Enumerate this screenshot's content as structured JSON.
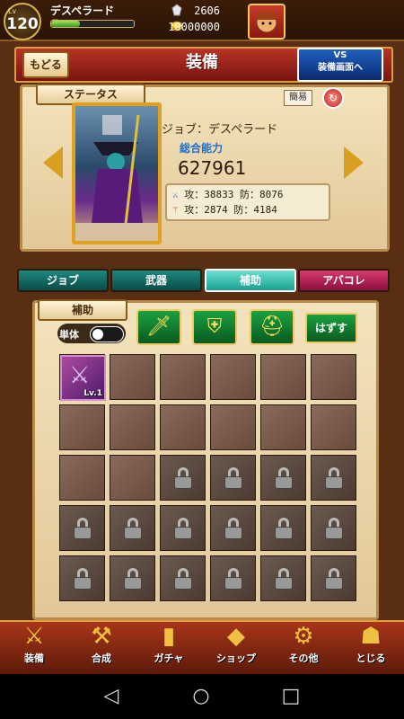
{
  "top_bar": {
    "level_tag": "Lv",
    "level": "120",
    "player_name": "デスペラード",
    "ep_label": "EP",
    "ep_fraction": 0.35,
    "currency1": "2606",
    "currency2": "10000000"
  },
  "header": {
    "back_label": "もどる",
    "title": "装備",
    "vs_line1": "VS",
    "vs_line2": "装備画面へ"
  },
  "status": {
    "tag": "ステータス",
    "simple_label": "簡易",
    "job_line": "ジョブ：デスペラード",
    "power_label": "総合能力",
    "power_value": "627961",
    "row1": "攻：38833  防：8076",
    "row2": "攻：2874   防：4184"
  },
  "tabs": [
    "ジョブ",
    "武器",
    "補助",
    "アバコレ"
  ],
  "support": {
    "tag": "補助",
    "single_label": "単体",
    "unequip_label": "はずす",
    "card_level": "Lv.1"
  },
  "bottom_menu": [
    "装備",
    "合成",
    "ガチャ",
    "ショップ",
    "その他",
    "とじる"
  ],
  "colors": {
    "accent": "#d8a020",
    "header_red": "#b83426",
    "tab_teal": "#1aa090"
  }
}
